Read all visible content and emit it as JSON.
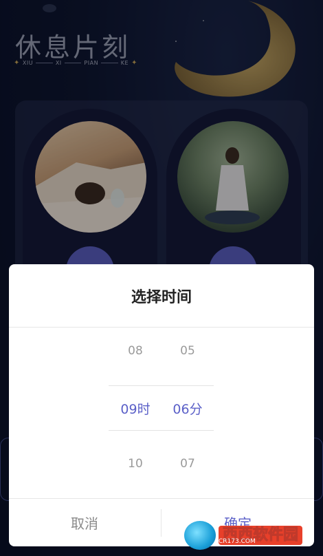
{
  "app": {
    "title": "休息片刻",
    "subtitle_parts": [
      "XIU",
      "XI",
      "PIAN",
      "KE"
    ]
  },
  "dialog": {
    "title": "选择时间",
    "hour_column": {
      "prev": "08",
      "selected": "09时",
      "next": "10"
    },
    "minute_column": {
      "prev": "05",
      "selected": "06分",
      "next": "07"
    },
    "cancel_label": "取消",
    "confirm_label": "确定"
  },
  "watermark": {
    "brand": "西西软件园",
    "site": "CR173.COM"
  },
  "colors": {
    "accent": "#5b60c8",
    "background": "#0d1530",
    "moon": "#c9a65a"
  }
}
